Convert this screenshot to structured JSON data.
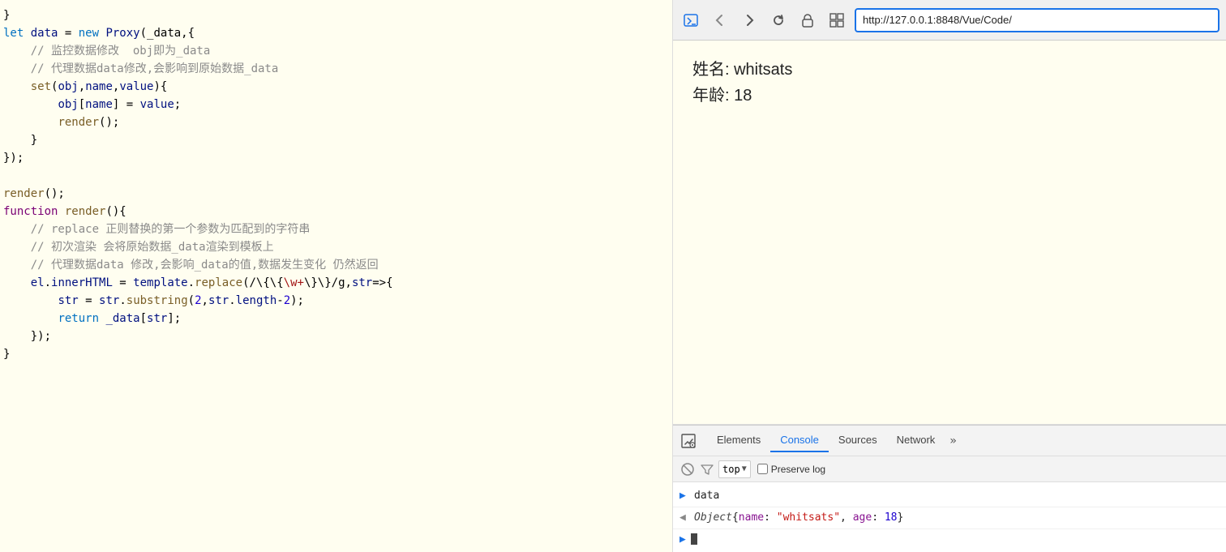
{
  "browser": {
    "url": "http://127.0.0.1:8848/Vue/Code/",
    "url_placeholder": "http://127.0.0.1:8848/Vue/Code/"
  },
  "preview": {
    "name_label": "姓名: whitsats",
    "age_label": "年龄: 18"
  },
  "devtools": {
    "tabs": [
      {
        "id": "elements",
        "label": "Elements",
        "active": false
      },
      {
        "id": "console",
        "label": "Console",
        "active": true
      },
      {
        "id": "sources",
        "label": "Sources",
        "active": false
      },
      {
        "id": "network",
        "label": "Network",
        "active": false
      }
    ],
    "more_label": "»",
    "console_context": "top",
    "preserve_log_label": "Preserve log"
  },
  "console": {
    "entries": [
      {
        "prompt": ">",
        "prompt_type": "right",
        "content": "data"
      },
      {
        "prompt": "←",
        "prompt_type": "left",
        "content": "Object {name: \"whitsats\", age: 18}"
      }
    ]
  },
  "code": {
    "lines": [
      {
        "num": "",
        "text": "}"
      },
      {
        "num": "",
        "text": "let data = new Proxy(_data,{"
      },
      {
        "num": "",
        "text": "    // 监控数据修改 obj即为_data"
      },
      {
        "num": "",
        "text": "    // 代理数据data修改,会影响到原始数据_data"
      },
      {
        "num": "",
        "text": "    set(obj,name,value){"
      },
      {
        "num": "",
        "text": "        obj[name] = value;"
      },
      {
        "num": "",
        "text": "        render();"
      },
      {
        "num": "",
        "text": "    }"
      },
      {
        "num": "",
        "text": "});"
      },
      {
        "num": "",
        "text": ""
      },
      {
        "num": "",
        "text": "render();"
      },
      {
        "num": "",
        "text": "function render(){"
      },
      {
        "num": "",
        "text": "    // replace 正则替换的第一个参数为匹配到的字符串"
      },
      {
        "num": "",
        "text": "    // 初次渲染 会将原始数据_data渲染到模板上"
      },
      {
        "num": "",
        "text": "    // 代理数据data 修改,会影响_data的值,数据发生变化 仍然返回"
      },
      {
        "num": "",
        "text": "    el.innerHTML = template.replace(/\\{\\{\\w+\\}\\}/g,str=>{"
      },
      {
        "num": "",
        "text": "        str = str.substring(2,str.length-2);"
      },
      {
        "num": "",
        "text": "        return _data[str];"
      },
      {
        "num": "",
        "text": "    });"
      },
      {
        "num": "",
        "text": "}"
      }
    ]
  }
}
